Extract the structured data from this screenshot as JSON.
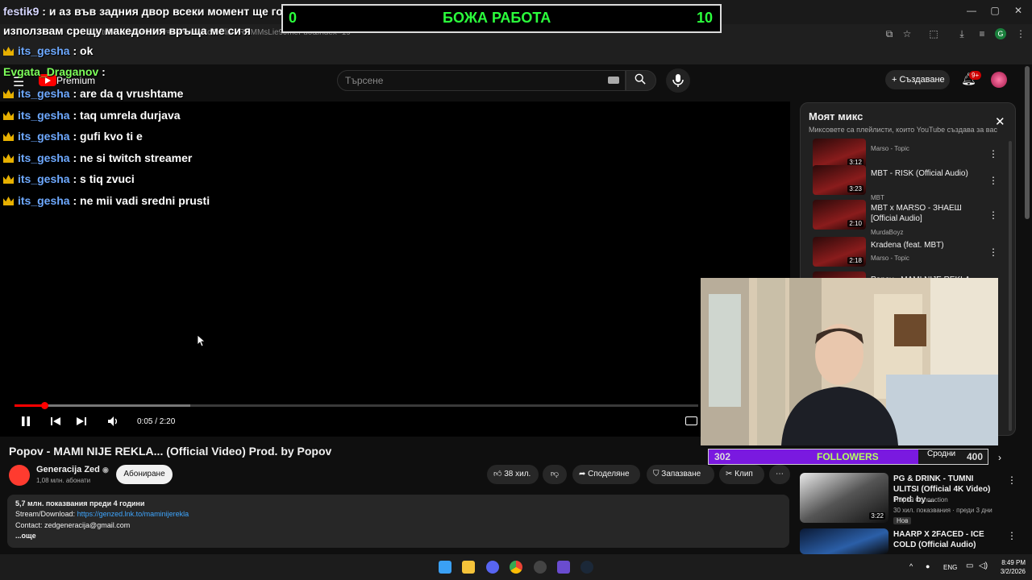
{
  "browser": {
    "url": "youtube.com/watch?v=wkNw4oKcTodlist=RDMMsLie9JmeFu0&index=19",
    "minimize": "—",
    "maximize": "▢",
    "close": "✕",
    "profile_letter": "G"
  },
  "youtube": {
    "premium_label": "Premium",
    "search_placeholder": "Търсене",
    "create_label": "+ Създаване",
    "notif_count": "9+"
  },
  "counter": {
    "left": "0",
    "title": "БОЖА РАБОТА",
    "right": "10"
  },
  "chat": [
    {
      "user": "festik9",
      "text": "и аз във задния двор всеки момент ще го",
      "badge": false
    },
    {
      "user": "",
      "text": "използвам срещу македония връща ме си я",
      "badge": false
    },
    {
      "user": "its_gesha",
      "text": "ok",
      "badge": true
    },
    {
      "user": "Evgata_Draganov",
      "text": "",
      "badge": false
    },
    {
      "user": "its_gesha",
      "text": "are da q vrushtame",
      "badge": true
    },
    {
      "user": "its_gesha",
      "text": "taq umrela durjava",
      "badge": true
    },
    {
      "user": "its_gesha",
      "text": "gufi kvo ti e",
      "badge": true
    },
    {
      "user": "its_gesha",
      "text": "ne si twitch streamer",
      "badge": true
    },
    {
      "user": "its_gesha",
      "text": "s tiq zvuci",
      "badge": true
    },
    {
      "user": "its_gesha",
      "text": "ne mii vadi sredni prusti",
      "badge": true
    }
  ],
  "player": {
    "time": "0:05 / 2:20",
    "progress": 0.04
  },
  "mix": {
    "title": "Моят микс",
    "subtitle": "Миксовете са плейлисти, които YouTube създава за вас",
    "items": [
      {
        "title": "",
        "channel": "Marso - Topic",
        "duration": "3:12"
      },
      {
        "title": "MBT - RISK (Official Audio)",
        "channel": "MBT",
        "duration": "3:23"
      },
      {
        "title": "MBT x MARSO - ЗНАЕШ [Official Audio]",
        "channel": "MurdaBoyz",
        "duration": "2:10"
      },
      {
        "title": "Kradena (feat. MBT)",
        "channel": "Marso - Topic",
        "duration": "2:18"
      },
      {
        "title": "Popov - MAMI NIJE REKLA",
        "channel": "",
        "duration": ""
      }
    ]
  },
  "followers": {
    "current": "302",
    "label": "FOLLOWERS",
    "goal": "400",
    "related_label": "Сродни"
  },
  "video": {
    "title": "Popov - MAMI NIJE REKLA... (Official Video) Prod. by Popov",
    "channel": "Generacija Zed",
    "subscribers": "1,08 млн. абонати",
    "subscribe_label": "Абониране",
    "likes": "38 хил.",
    "share_label": "Споделяне",
    "save_label": "Запазване",
    "clip_label": "Клип",
    "views_line": "5,7 млн. показвания  преди 4 години",
    "stream_label": "Stream/Download:",
    "stream_link": "https://genzed.lnk.to/maminijerekla",
    "contact": "Contact: zedgeneracija@gmail.com",
    "more": "...още"
  },
  "recommendations": [
    {
      "title": "PG & DRINK - TUMNI ULITSI (Official 4K Video) Prod. by ...",
      "channel": "Trap19 Connection",
      "meta": "30 хил. показвания · преди 3 дни",
      "badge": "Нов",
      "duration": "3:22"
    },
    {
      "title": "HAARP X 2FACED - ICE COLD (Official Audio)",
      "channel": "",
      "meta": "",
      "badge": "",
      "duration": ""
    }
  ],
  "taskbar": {
    "lang": "ENG",
    "time": "8:49 PM",
    "date": "3/2/2026"
  }
}
